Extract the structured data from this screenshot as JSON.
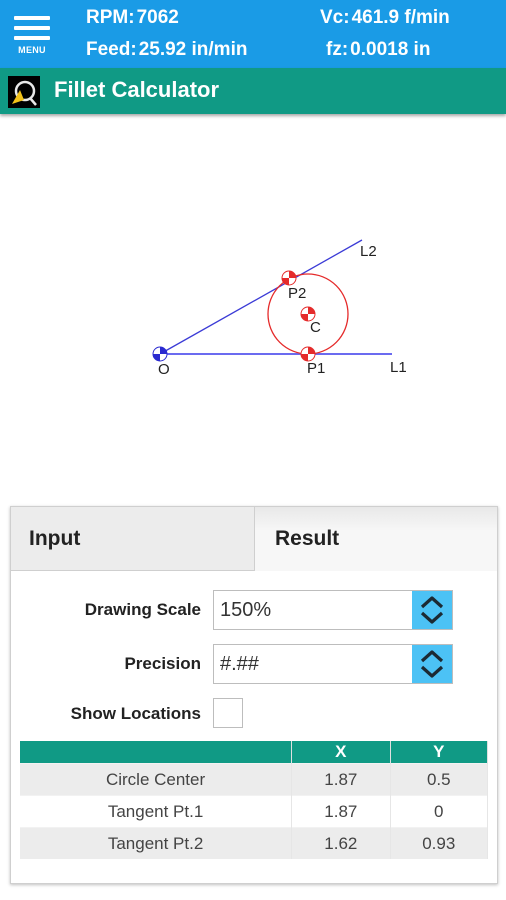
{
  "status_bar": {
    "rpm_label": "RPM:",
    "rpm_value": "7062",
    "feed_label": "Feed:",
    "feed_value": "25.92 in/min",
    "vc_label": "Vc:",
    "vc_value": "461.9 f/min",
    "fz_label": "fz:",
    "fz_value": "0.0018 in",
    "menu_label": "MENU",
    "background_color": "#1a9be6"
  },
  "title_bar": {
    "title": "Fillet Calculator",
    "background_color": "#109a85",
    "logo_icon": "calipers-logo-icon"
  },
  "drawing": {
    "labels": {
      "origin": "O",
      "line1": "L1",
      "line2": "L2",
      "tangent1": "P1",
      "tangent2": "P2",
      "center": "C"
    },
    "line_color": "#3b3bd6",
    "circle_color": "#e52b2b"
  },
  "tabs": [
    {
      "label": "Input",
      "selected": false
    },
    {
      "label": "Result",
      "selected": true
    }
  ],
  "form": {
    "drawing_scale_label": "Drawing Scale",
    "drawing_scale_value": "150%",
    "precision_label": "Precision",
    "precision_value": "#.##",
    "show_locations_label": "Show Locations",
    "show_locations_checked": false
  },
  "result_table": {
    "headers": [
      "",
      "X",
      "Y"
    ],
    "rows": [
      [
        "Circle Center",
        "1.87",
        "0.5"
      ],
      [
        "Tangent Pt.1",
        "1.87",
        "0"
      ],
      [
        "Tangent Pt.2",
        "1.62",
        "0.93"
      ]
    ],
    "header_color": "#109a85"
  },
  "spinner_color": "#4cc2f5"
}
